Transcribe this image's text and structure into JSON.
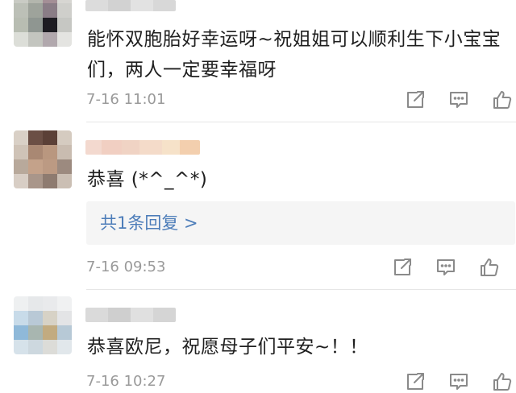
{
  "comments": [
    {
      "text": "能怀双胞胎好幸运呀~祝姐姐可以顺利生下小宝宝们，两人一定要幸福呀",
      "time": "7-16  11:01"
    },
    {
      "text": "恭喜 (*^_^*)",
      "reply_label": "共1条回复 >",
      "time": "7-16  09:53"
    },
    {
      "text": "恭喜欧尼，祝愿母子们平安~！！",
      "time": "7-16  10:27"
    }
  ],
  "icons": [
    "share-icon",
    "comment-icon",
    "like-icon"
  ],
  "colors": {
    "text": "#1f1f1f",
    "time": "#9a9a9a",
    "icon": "#8a8a8a",
    "link": "#4d7db9",
    "reply_bg": "#f5f5f5",
    "divider": "#e6e6e6"
  }
}
